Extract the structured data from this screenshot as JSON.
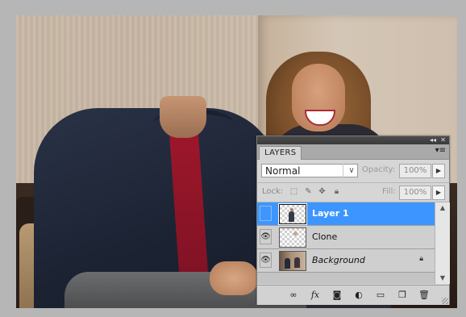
{
  "panel": {
    "tab_label": "LAYERS",
    "collapse_glyph": "◂◂",
    "close_glyph": "✕",
    "menu_glyph": "▾≡",
    "blend_mode": "Normal",
    "opacity_label": "Opacity:",
    "opacity_value": "100%",
    "lock_label": "Lock:",
    "fill_label": "Fill:",
    "fill_value": "100%"
  },
  "layers": [
    {
      "name": "Layer 1",
      "selected": true,
      "visible": false
    },
    {
      "name": "Clone",
      "selected": false,
      "visible": true
    },
    {
      "name": "Background",
      "selected": false,
      "visible": true,
      "locked": true
    }
  ],
  "footer_icons": [
    "link-icon",
    "fx-icon",
    "mask-icon",
    "adjustment-icon",
    "folder-icon",
    "new-layer-icon",
    "trash-icon"
  ],
  "colors": {
    "selection": "#3d96ff",
    "panel_bg": "#d6d6d6",
    "shirt_accent": "#a0172b"
  }
}
